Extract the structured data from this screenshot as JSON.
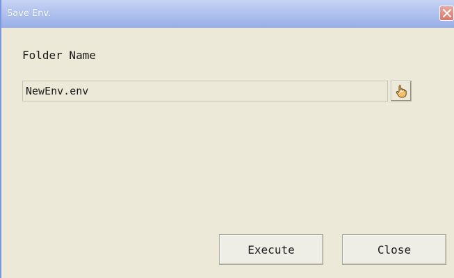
{
  "window": {
    "title": "Save Env.",
    "close_icon": "close-icon"
  },
  "form": {
    "folder_label": "Folder Name",
    "folder_value": "NewEnv.env",
    "browse_icon": "pointing-hand-icon"
  },
  "actions": {
    "execute_label": "Execute",
    "close_label": "Close"
  },
  "colors": {
    "dialog_background": "#ece9d8",
    "titlebar": "#a3b7ea",
    "close_button": "#d8776a"
  }
}
